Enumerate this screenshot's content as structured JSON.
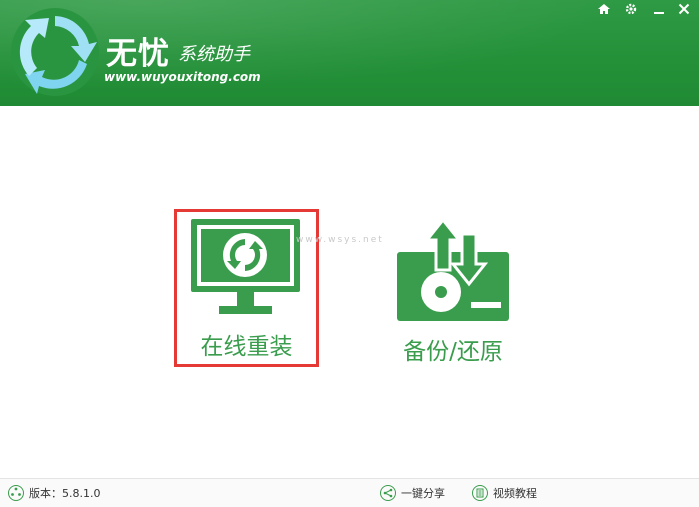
{
  "app": {
    "name": "无忧",
    "subtitle": "系统助手",
    "url": "www.wuyouxitong.com"
  },
  "window_controls": [
    {
      "name": "home",
      "icon": "home-icon"
    },
    {
      "name": "settings",
      "icon": "gear-icon"
    },
    {
      "name": "minimize",
      "icon": "minimize-icon"
    },
    {
      "name": "close",
      "icon": "close-icon"
    }
  ],
  "actions": {
    "reinstall_label": "在线重装",
    "backup_label": "备份/还原",
    "selected": "reinstall"
  },
  "watermark": "www.wsys.net",
  "statusbar": {
    "version_label": "版本：5.8.1.0",
    "share_label": "一键分享",
    "tutorial_label": "视频教程"
  },
  "colors": {
    "brand_green": "#249139",
    "icon_green": "#3a9d4d",
    "selection_red": "#e53935"
  }
}
